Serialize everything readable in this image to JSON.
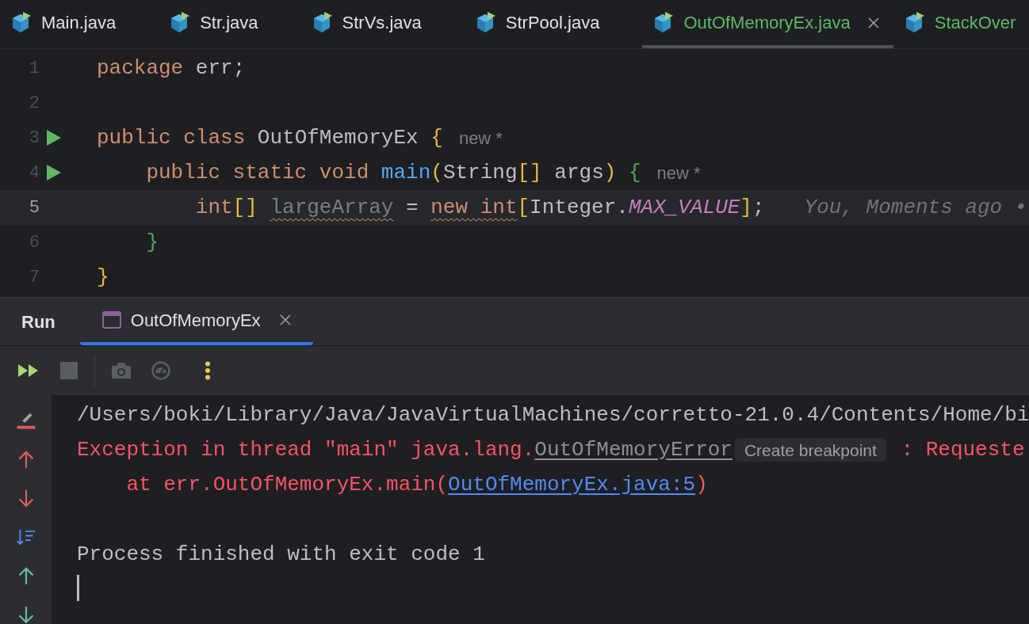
{
  "editor_tabs": [
    {
      "label": "Main.java",
      "selected": false,
      "added": false
    },
    {
      "label": "Str.java",
      "selected": false,
      "added": false
    },
    {
      "label": "StrVs.java",
      "selected": false,
      "added": false
    },
    {
      "label": "StrPool.java",
      "selected": false,
      "added": false
    },
    {
      "label": "OutOfMemoryEx.java",
      "selected": true,
      "added": true
    },
    {
      "label": "StackOver",
      "selected": false,
      "added": true
    }
  ],
  "code_lines": [
    {
      "number": "1",
      "run": false,
      "selected": false,
      "code": [
        {
          "kind": "keyword",
          "text": "package"
        },
        {
          "kind": "plain",
          "text": " err;"
        }
      ]
    },
    {
      "number": "2",
      "run": false,
      "selected": false
    },
    {
      "number": "3",
      "run": true,
      "selected": false,
      "code": [
        {
          "kind": "keyword",
          "text": "public class"
        },
        {
          "kind": "plain",
          "text": " OutOfMemoryEx "
        },
        {
          "kind": "brace1",
          "text": "{"
        }
      ],
      "hint": "new *",
      "children": [
        {
          "number": "4",
          "run": true,
          "selected": false,
          "code": [
            {
              "kind": "keyword",
              "text": "public static void "
            },
            {
              "kind": "function",
              "text": "main"
            },
            {
              "kind": "brace1",
              "text": "("
            },
            {
              "kind": "plain",
              "text": "String"
            },
            {
              "kind": "brace1",
              "text": "[]"
            },
            {
              "kind": "plain",
              "text": " args"
            },
            {
              "kind": "brace1",
              "text": ")"
            },
            {
              "kind": "brace2",
              "text": " {"
            }
          ],
          "hint": "new *",
          "children": [
            {
              "number": "5",
              "run": false,
              "selected": true,
              "code": [
                {
                  "kind": "keyword",
                  "text": "int"
                },
                {
                  "kind": "brace1",
                  "text": "[] "
                },
                {
                  "kind": "unused",
                  "text": "largeArray",
                  "warning": true
                },
                {
                  "kind": "plain",
                  "text": " = "
                },
                {
                  "kind": "keyword",
                  "text": "new int",
                  "warning": true
                },
                {
                  "kind": "brace1",
                  "text": "["
                },
                {
                  "kind": "plain",
                  "text": "Integer."
                },
                {
                  "kind": "constant",
                  "text": "MAX_VALUE"
                },
                {
                  "kind": "brace1",
                  "text": "]"
                },
                {
                  "kind": "plain",
                  "text": ";"
                }
              ],
              "blame": "You, Moments ago •"
            }
          ]
        },
        {
          "number": "6",
          "run": false,
          "selected": false,
          "code": [
            {
              "kind": "brace2",
              "text": "}"
            }
          ]
        }
      ]
    },
    {
      "number": "7",
      "run": false,
      "selected": false,
      "code": [
        {
          "kind": "brace1",
          "text": "}"
        }
      ]
    }
  ],
  "run_panel": {
    "title": "Run",
    "tabs": [
      {
        "label": "OutOfMemoryEx",
        "selected": true
      }
    ],
    "console": [
      {
        "kind": "output",
        "segments": [
          {
            "kind": "text",
            "text": "/Users/boki/Library/Java/JavaVirtualMachines/corretto-21.0.4/Contents/Home/bi"
          }
        ]
      },
      {
        "kind": "output",
        "segments": [
          {
            "kind": "error_text",
            "text": "Exception in thread \"main\" java.lang."
          },
          {
            "kind": "class_link",
            "text": "OutOfMemoryError"
          },
          {
            "kind": "chip",
            "text": "Create breakpoint"
          },
          {
            "kind": "error_text",
            "text": " : Requeste"
          }
        ]
      },
      {
        "kind": "output",
        "segments": [
          {
            "kind": "error_text",
            "text": "    at err.OutOfMemoryEx.main("
          },
          {
            "kind": "link",
            "text": "OutOfMemoryEx.java:5"
          },
          {
            "kind": "error_text",
            "text": ")"
          }
        ]
      },
      {
        "kind": "blank"
      },
      {
        "kind": "output",
        "segments": [
          {
            "kind": "text",
            "text": "Process finished with exit code 1"
          }
        ]
      }
    ]
  }
}
